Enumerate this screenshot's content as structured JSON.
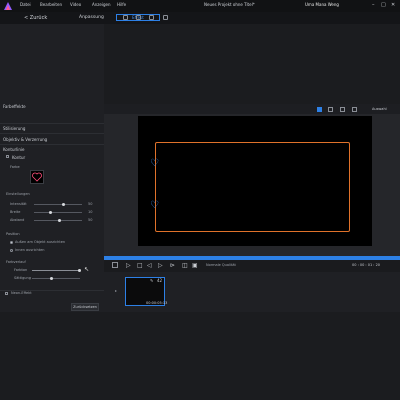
{
  "menu": [
    "Datei",
    "Bearbeiten",
    "Video",
    "Anzeigen",
    "Hilfe"
  ],
  "window_title": "Neues Projekt ohne Titel*",
  "user_name": "Uma Mana Weng",
  "toolbar": {
    "back_label": "< Zurück",
    "adjust_label": "Anpassung",
    "tab_label": "Effekt"
  },
  "left_panel": {
    "sections": [
      "Farbeffekte",
      "Stilisierung",
      "Objektiv & Verzerrung",
      "Konturlinie"
    ],
    "contour": "Kontur",
    "settings_header": "Einstellungen",
    "sliders": [
      {
        "label": "Intensität",
        "value": "50",
        "fill": 0.7
      },
      {
        "label": "Breite",
        "value": "10",
        "fill": 0.35
      },
      {
        "label": "Abstand",
        "value": "50",
        "fill": 0.55
      }
    ],
    "position_header": "Position",
    "radio_options": [
      "Außen am Objekt ausrichten",
      "Innen ausrichten"
    ],
    "selected_radio": 0,
    "color_header": "Farbverlauf",
    "color_sliders": [
      {
        "label": "Farbton",
        "value": "",
        "fill": 0.95
      },
      {
        "label": "Sättigung",
        "value": "",
        "fill": 0.4
      }
    ],
    "thumb_label": "Farbe",
    "bottom_section": "Neon-Effekt",
    "reset_label": "Zurücksetzen"
  },
  "preview": {
    "tool_label": "Auswahl"
  },
  "timeline": {
    "quality_label": "Normale Qualität",
    "timecode": "00 : 00 : 01 : 20"
  },
  "clip": {
    "number": "42",
    "time": "00:00:05:13"
  }
}
